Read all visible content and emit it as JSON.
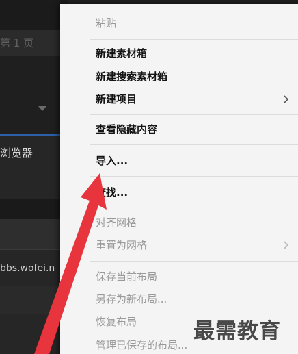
{
  "background_panel": {
    "page_label": "第 1 页",
    "browser_label": "浏览器",
    "url_fragment": "bbs.wofei.n"
  },
  "context_menu": {
    "items": [
      {
        "label": "粘贴",
        "enabled": false,
        "has_submenu": false
      },
      {
        "label": "新建素材箱",
        "enabled": true,
        "has_submenu": false
      },
      {
        "label": "新建搜索素材箱",
        "enabled": true,
        "has_submenu": false
      },
      {
        "label": "新建项目",
        "enabled": true,
        "has_submenu": true
      },
      {
        "label": "查看隐藏内容",
        "enabled": true,
        "has_submenu": false
      },
      {
        "label": "导入...",
        "enabled": true,
        "has_submenu": false
      },
      {
        "label": "查找...",
        "enabled": true,
        "has_submenu": false
      },
      {
        "label": "对齐网格",
        "enabled": false,
        "has_submenu": false
      },
      {
        "label": "重置为网格",
        "enabled": false,
        "has_submenu": true
      },
      {
        "label": "保存当前布局",
        "enabled": false,
        "has_submenu": false
      },
      {
        "label": "另存为新布局...",
        "enabled": false,
        "has_submenu": false
      },
      {
        "label": "恢复布局",
        "enabled": false,
        "has_submenu": false
      },
      {
        "label": "管理已保存的布局...",
        "enabled": false,
        "has_submenu": false
      }
    ]
  },
  "annotation": {
    "color": "#e8343c",
    "points_to": "导入..."
  },
  "watermark": {
    "text": "最需教育"
  },
  "colors": {
    "menu_background": "#f4f4f4",
    "enabled_text": "#141414",
    "disabled_text": "#9a9a9a",
    "panel_background": "#232323",
    "accent_blue": "#2d5fa8"
  }
}
